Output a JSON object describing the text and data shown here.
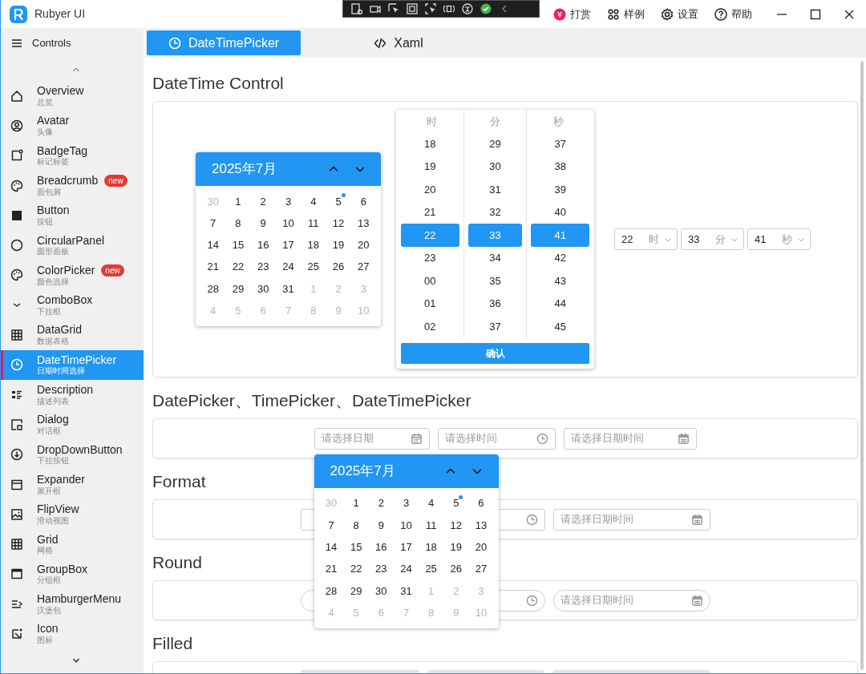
{
  "window": {
    "title": "Rubyer UI"
  },
  "header_actions": [
    {
      "label": "打赏"
    },
    {
      "label": "样例"
    },
    {
      "label": "设置"
    },
    {
      "label": "帮助"
    }
  ],
  "sidebar": {
    "title": "Controls",
    "items": [
      {
        "title": "Overview",
        "subtitle": "总览",
        "selected": false
      },
      {
        "title": "Avatar",
        "subtitle": "头像",
        "selected": false
      },
      {
        "title": "BadgeTag",
        "subtitle": "标记标签",
        "selected": false
      },
      {
        "title": "Breadcrumb",
        "subtitle": "面包屑",
        "badge": "new",
        "selected": false
      },
      {
        "title": "Button",
        "subtitle": "按钮",
        "selected": false
      },
      {
        "title": "CircularPanel",
        "subtitle": "圆形面板",
        "selected": false
      },
      {
        "title": "ColorPicker",
        "subtitle": "颜色选择",
        "badge": "new",
        "selected": false
      },
      {
        "title": "ComboBox",
        "subtitle": "下拉框",
        "selected": false
      },
      {
        "title": "DataGrid",
        "subtitle": "数据表格",
        "selected": false
      },
      {
        "title": "DateTimePicker",
        "subtitle": "日期时间选择",
        "selected": true
      },
      {
        "title": "Description",
        "subtitle": "描述列表",
        "selected": false
      },
      {
        "title": "Dialog",
        "subtitle": "对话框",
        "selected": false
      },
      {
        "title": "DropDownButton",
        "subtitle": "下拉按钮",
        "selected": false
      },
      {
        "title": "Expander",
        "subtitle": "展开框",
        "selected": false
      },
      {
        "title": "FlipView",
        "subtitle": "滑动视图",
        "selected": false
      },
      {
        "title": "Grid",
        "subtitle": "网格",
        "selected": false
      },
      {
        "title": "GroupBox",
        "subtitle": "分组框",
        "selected": false
      },
      {
        "title": "HamburgerMenu",
        "subtitle": "汉堡包",
        "selected": false
      },
      {
        "title": "Icon",
        "subtitle": "图标",
        "selected": false
      }
    ]
  },
  "tabs": [
    {
      "label": "DateTimePicker",
      "selected": true
    },
    {
      "label": "Xaml",
      "selected": false
    }
  ],
  "datetime_control": {
    "heading": "DateTime Control",
    "calendar": {
      "month": "2025年7月",
      "days": [
        {
          "d": "30",
          "outside": true,
          "today": false
        },
        {
          "d": "1",
          "outside": false,
          "today": false
        },
        {
          "d": "2",
          "outside": false,
          "today": false
        },
        {
          "d": "3",
          "outside": false,
          "today": false
        },
        {
          "d": "4",
          "outside": false,
          "today": false
        },
        {
          "d": "5",
          "outside": false,
          "today": true
        },
        {
          "d": "6",
          "outside": false,
          "today": false
        },
        {
          "d": "7",
          "outside": false,
          "today": false
        },
        {
          "d": "8",
          "outside": false,
          "today": false
        },
        {
          "d": "9",
          "outside": false,
          "today": false
        },
        {
          "d": "10",
          "outside": false,
          "today": false
        },
        {
          "d": "11",
          "outside": false,
          "today": false
        },
        {
          "d": "12",
          "outside": false,
          "today": false
        },
        {
          "d": "13",
          "outside": false,
          "today": false
        },
        {
          "d": "14",
          "outside": false,
          "today": false
        },
        {
          "d": "15",
          "outside": false,
          "today": false
        },
        {
          "d": "16",
          "outside": false,
          "today": false
        },
        {
          "d": "17",
          "outside": false,
          "today": false
        },
        {
          "d": "18",
          "outside": false,
          "today": false
        },
        {
          "d": "19",
          "outside": false,
          "today": false
        },
        {
          "d": "20",
          "outside": false,
          "today": false
        },
        {
          "d": "21",
          "outside": false,
          "today": false
        },
        {
          "d": "22",
          "outside": false,
          "today": false
        },
        {
          "d": "23",
          "outside": false,
          "today": false
        },
        {
          "d": "24",
          "outside": false,
          "today": false
        },
        {
          "d": "25",
          "outside": false,
          "today": false
        },
        {
          "d": "26",
          "outside": false,
          "today": false
        },
        {
          "d": "27",
          "outside": false,
          "today": false
        },
        {
          "d": "28",
          "outside": false,
          "today": false
        },
        {
          "d": "29",
          "outside": false,
          "today": false
        },
        {
          "d": "30",
          "outside": false,
          "today": false
        },
        {
          "d": "31",
          "outside": false,
          "today": false
        },
        {
          "d": "1",
          "outside": true,
          "today": false
        },
        {
          "d": "2",
          "outside": true,
          "today": false
        },
        {
          "d": "3",
          "outside": true,
          "today": false
        },
        {
          "d": "4",
          "outside": true,
          "today": false
        },
        {
          "d": "5",
          "outside": true,
          "today": false
        },
        {
          "d": "6",
          "outside": true,
          "today": false
        },
        {
          "d": "7",
          "outside": true,
          "today": false
        },
        {
          "d": "8",
          "outside": true,
          "today": false
        },
        {
          "d": "9",
          "outside": true,
          "today": false
        },
        {
          "d": "10",
          "outside": true,
          "today": false
        }
      ]
    },
    "time_picker": {
      "columns": [
        {
          "header": "时",
          "values": [
            {
              "v": "18",
              "selected": false
            },
            {
              "v": "19",
              "selected": false
            },
            {
              "v": "20",
              "selected": false
            },
            {
              "v": "21",
              "selected": false
            },
            {
              "v": "22",
              "selected": true
            },
            {
              "v": "23",
              "selected": false
            },
            {
              "v": "00",
              "selected": false
            },
            {
              "v": "01",
              "selected": false
            },
            {
              "v": "02",
              "selected": false
            }
          ]
        },
        {
          "header": "分",
          "values": [
            {
              "v": "29",
              "selected": false
            },
            {
              "v": "30",
              "selected": false
            },
            {
              "v": "31",
              "selected": false
            },
            {
              "v": "32",
              "selected": false
            },
            {
              "v": "33",
              "selected": true
            },
            {
              "v": "34",
              "selected": false
            },
            {
              "v": "35",
              "selected": false
            },
            {
              "v": "36",
              "selected": false
            },
            {
              "v": "37",
              "selected": false
            }
          ]
        },
        {
          "header": "秒",
          "values": [
            {
              "v": "37",
              "selected": false
            },
            {
              "v": "38",
              "selected": false
            },
            {
              "v": "39",
              "selected": false
            },
            {
              "v": "40",
              "selected": false
            },
            {
              "v": "41",
              "selected": true
            },
            {
              "v": "42",
              "selected": false
            },
            {
              "v": "43",
              "selected": false
            },
            {
              "v": "44",
              "selected": false
            },
            {
              "v": "45",
              "selected": false
            }
          ]
        }
      ],
      "confirm": "确认"
    },
    "combos": [
      {
        "value": "22",
        "unit": "时"
      },
      {
        "value": "33",
        "unit": "分"
      },
      {
        "value": "41",
        "unit": "秒"
      }
    ]
  },
  "sections": [
    {
      "heading": "DatePicker、TimePicker、DateTimePicker",
      "kind": "outline",
      "fields": [
        {
          "kind": "date",
          "placeholder": "请选择日期"
        },
        {
          "kind": "time",
          "placeholder": "请选择时间"
        },
        {
          "kind": "datetime",
          "placeholder": "请选择日期时间"
        }
      ]
    },
    {
      "heading": "Format",
      "kind": "outline",
      "fields": [
        {
          "kind": "date"
        },
        {
          "kind": "time"
        },
        {
          "kind": "datetime",
          "placeholder": "请选择日期时间"
        }
      ]
    },
    {
      "heading": "Round",
      "kind": "round",
      "fields": [
        {
          "kind": "date"
        },
        {
          "kind": "time"
        },
        {
          "kind": "datetime",
          "placeholder": "请选择日期时间"
        }
      ]
    },
    {
      "heading": "Filled",
      "kind": "filled",
      "fields": [
        {
          "kind": "date"
        },
        {
          "kind": "time"
        },
        {
          "kind": "datetime"
        }
      ]
    }
  ],
  "popup_calendar": {
    "month": "2025年7月",
    "days": [
      {
        "d": "30",
        "outside": true,
        "today": false
      },
      {
        "d": "1",
        "outside": false,
        "today": false
      },
      {
        "d": "2",
        "outside": false,
        "today": false
      },
      {
        "d": "3",
        "outside": false,
        "today": false
      },
      {
        "d": "4",
        "outside": false,
        "today": false
      },
      {
        "d": "5",
        "outside": false,
        "today": true
      },
      {
        "d": "6",
        "outside": false,
        "today": false
      },
      {
        "d": "7",
        "outside": false,
        "today": false
      },
      {
        "d": "8",
        "outside": false,
        "today": false
      },
      {
        "d": "9",
        "outside": false,
        "today": false
      },
      {
        "d": "10",
        "outside": false,
        "today": false
      },
      {
        "d": "11",
        "outside": false,
        "today": false
      },
      {
        "d": "12",
        "outside": false,
        "today": false
      },
      {
        "d": "13",
        "outside": false,
        "today": false
      },
      {
        "d": "14",
        "outside": false,
        "today": false
      },
      {
        "d": "15",
        "outside": false,
        "today": false
      },
      {
        "d": "16",
        "outside": false,
        "today": false
      },
      {
        "d": "17",
        "outside": false,
        "today": false
      },
      {
        "d": "18",
        "outside": false,
        "today": false
      },
      {
        "d": "19",
        "outside": false,
        "today": false
      },
      {
        "d": "20",
        "outside": false,
        "today": false
      },
      {
        "d": "21",
        "outside": false,
        "today": false
      },
      {
        "d": "22",
        "outside": false,
        "today": false
      },
      {
        "d": "23",
        "outside": false,
        "today": false
      },
      {
        "d": "24",
        "outside": false,
        "today": false
      },
      {
        "d": "25",
        "outside": false,
        "today": false
      },
      {
        "d": "26",
        "outside": false,
        "today": false
      },
      {
        "d": "27",
        "outside": false,
        "today": false
      },
      {
        "d": "28",
        "outside": false,
        "today": false
      },
      {
        "d": "29",
        "outside": false,
        "today": false
      },
      {
        "d": "30",
        "outside": false,
        "today": false
      },
      {
        "d": "31",
        "outside": false,
        "today": false
      },
      {
        "d": "1",
        "outside": true,
        "today": false
      },
      {
        "d": "2",
        "outside": true,
        "today": false
      },
      {
        "d": "3",
        "outside": true,
        "today": false
      },
      {
        "d": "4",
        "outside": true,
        "today": false
      },
      {
        "d": "5",
        "outside": true,
        "today": false
      },
      {
        "d": "6",
        "outside": true,
        "today": false
      },
      {
        "d": "7",
        "outside": true,
        "today": false
      },
      {
        "d": "8",
        "outside": true,
        "today": false
      },
      {
        "d": "9",
        "outside": true,
        "today": false
      },
      {
        "d": "10",
        "outside": true,
        "today": false
      }
    ]
  }
}
